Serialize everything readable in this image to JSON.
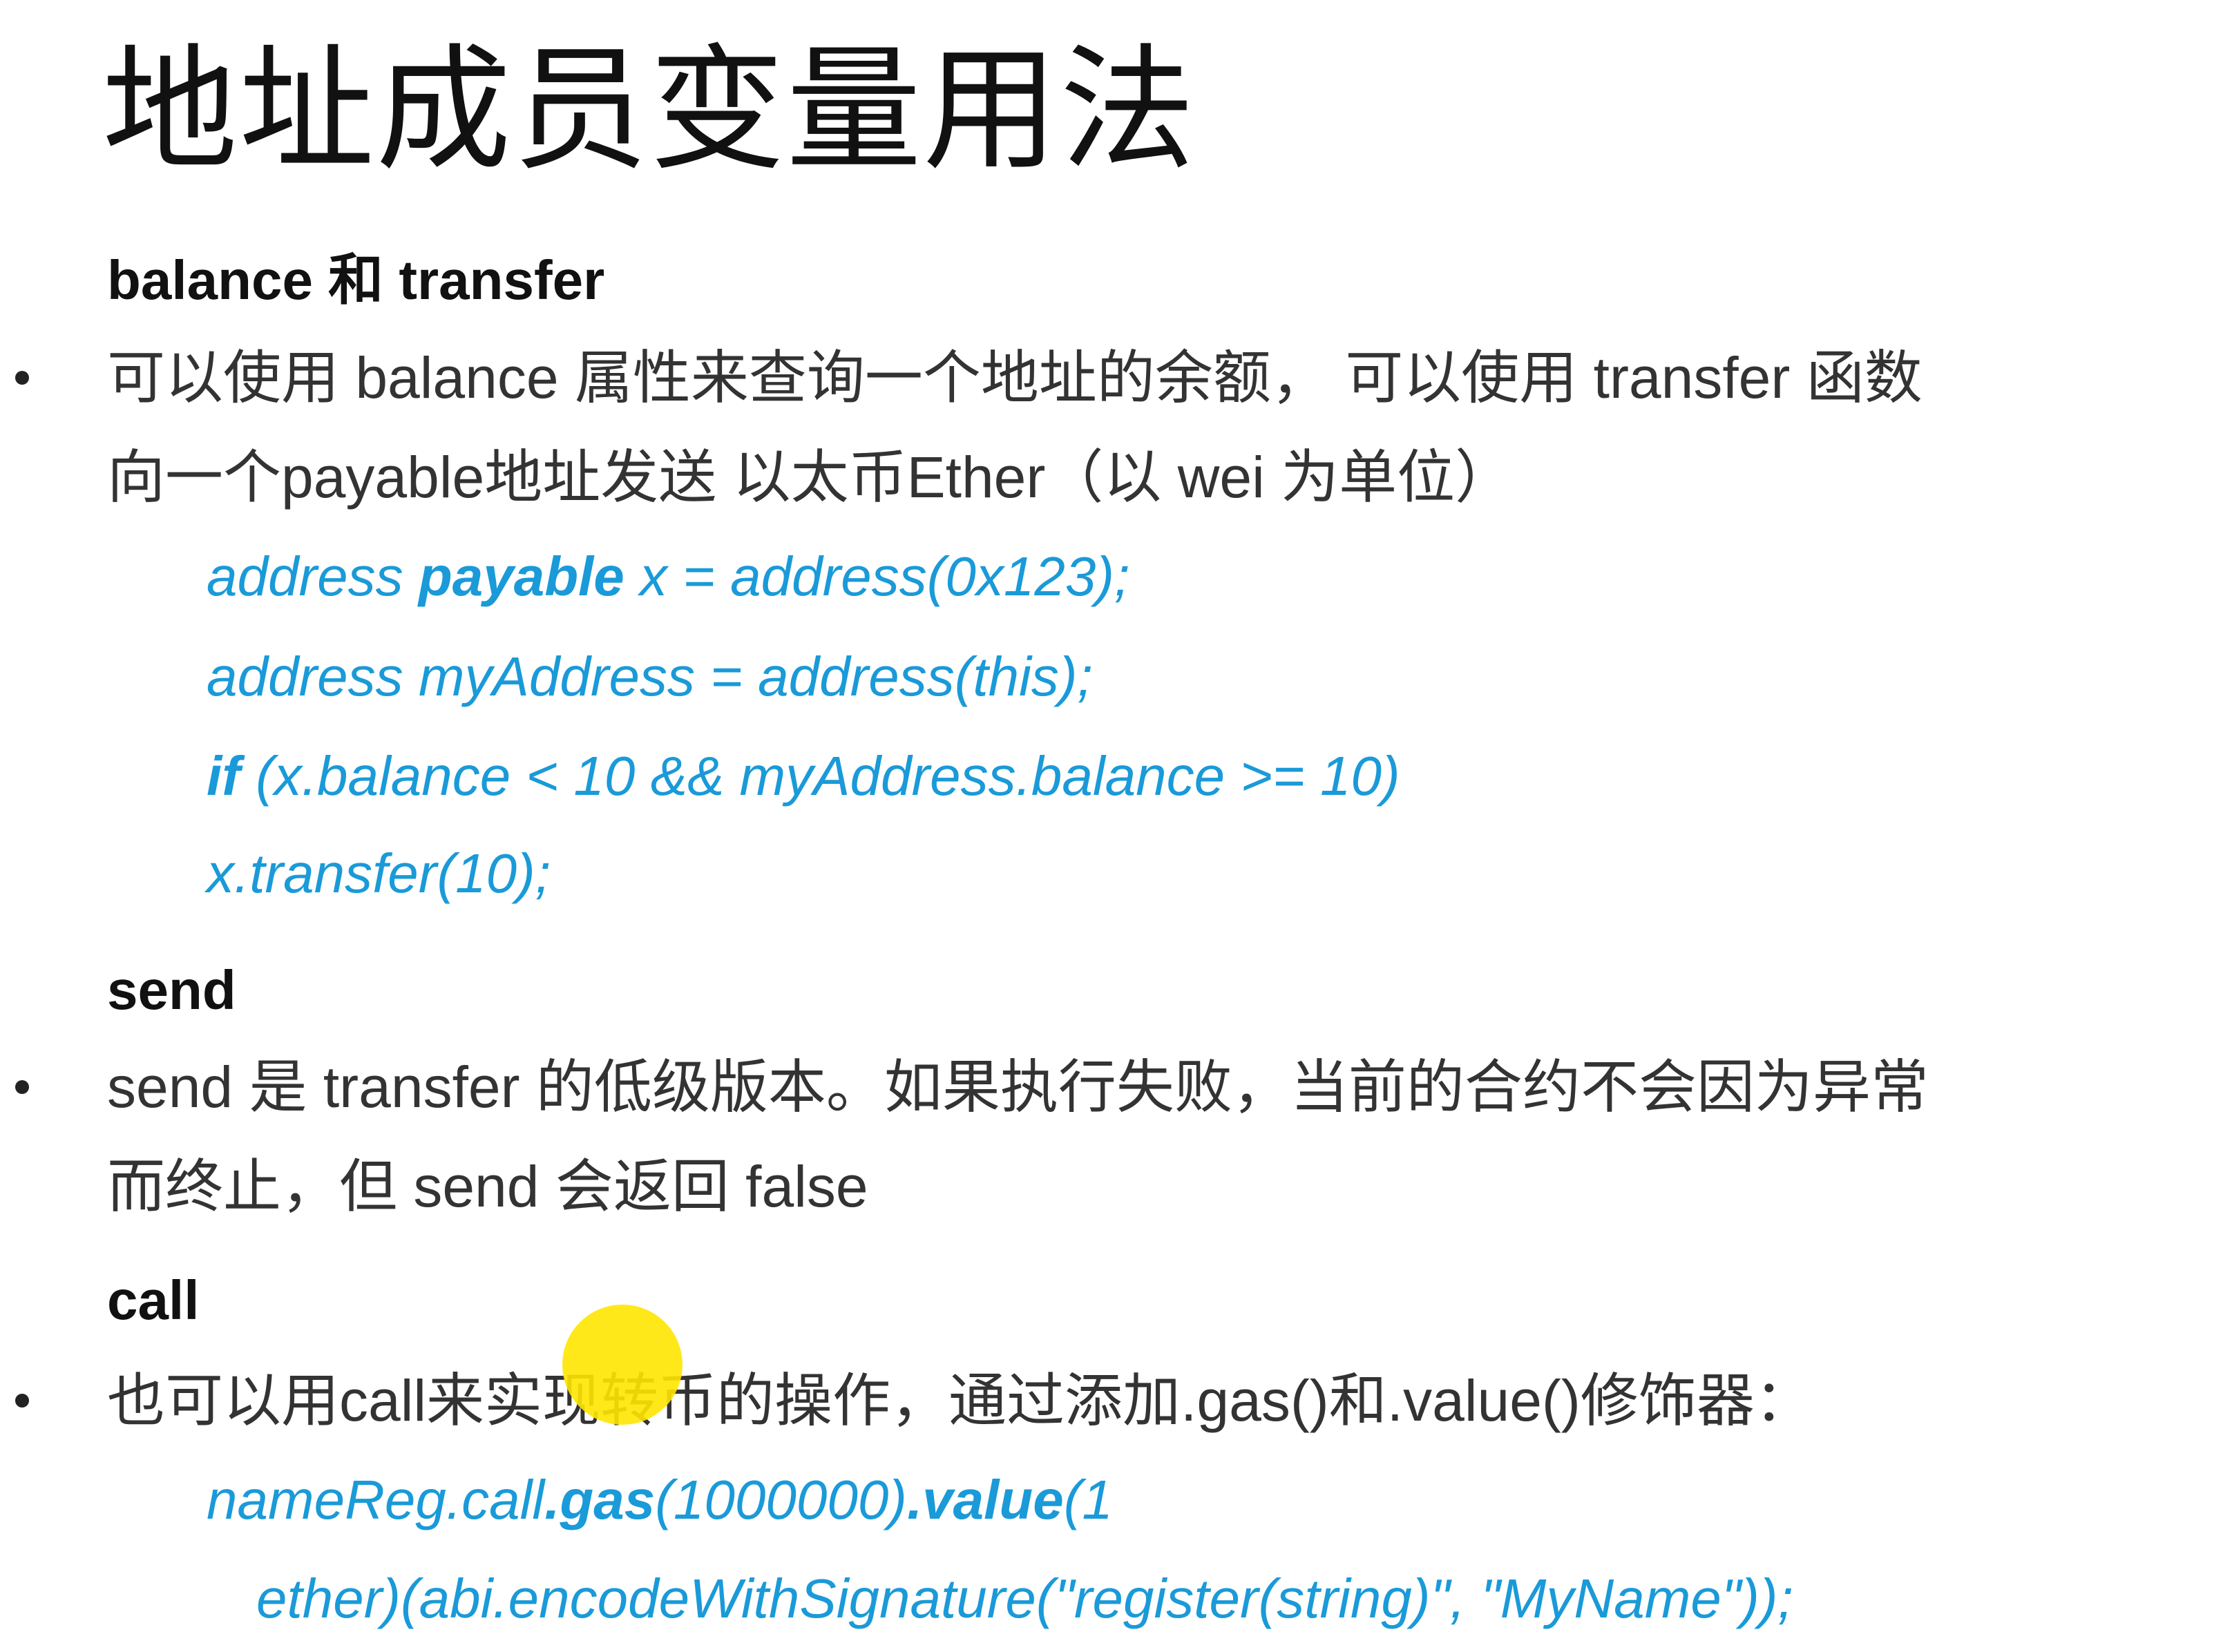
{
  "title": "地址成员变量用法",
  "sections": [
    {
      "heading": "balance 和 transfer",
      "bullet_lines": [
        "可以使用 balance 属性来查询一个地址的余额， 可以使用 transfer 函数",
        "向一个payable地址发送 以太币Ether（以 wei 为单位）"
      ],
      "code": {
        "l1_a": "address ",
        "l1_b": "payable",
        "l1_c": " x = address(0x123);",
        "l2": "address myAddress = address(this);",
        "l3_a": "if",
        "l3_b": " (x.balance < 10 && myAddress.balance >= 10)",
        "l4": "x.transfer(10);"
      }
    },
    {
      "heading": "send",
      "bullet_lines": [
        "send 是 transfer 的低级版本。如果执行失败，当前的合约不会因为异常",
        "而终止，但 send 会返回 false"
      ]
    },
    {
      "heading": "call",
      "bullet_lines": [
        "也可以用call来实现转币的操作，通过添加.gas()和.value()修饰器："
      ],
      "code": {
        "l1_a": "nameReg.call",
        "l1_b": ".gas",
        "l1_c": "(1000000)",
        "l1_d": ".value",
        "l1_e": "(1",
        "l2": "ether)(abi.encodeWithSignature(\"register(string)\", \"MyName\"));"
      }
    }
  ],
  "colors": {
    "code": "#1a9ad8",
    "text": "#333333",
    "cursor_highlight": "#ffe600"
  }
}
